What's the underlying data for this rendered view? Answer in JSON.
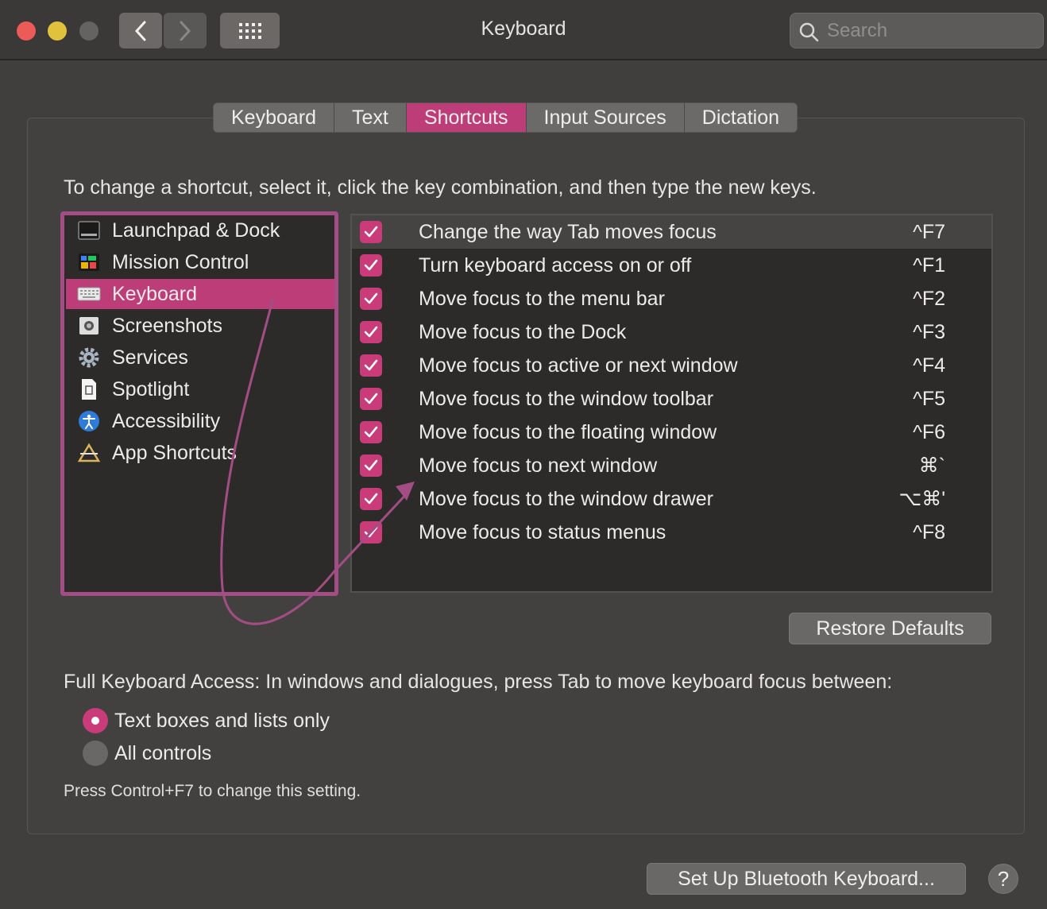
{
  "window": {
    "title": "Keyboard",
    "search_placeholder": "Search"
  },
  "tabs": [
    {
      "label": "Keyboard",
      "active": false
    },
    {
      "label": "Text",
      "active": false
    },
    {
      "label": "Shortcuts",
      "active": true
    },
    {
      "label": "Input Sources",
      "active": false
    },
    {
      "label": "Dictation",
      "active": false
    }
  ],
  "instruction": "To change a shortcut, select it, click the key combination, and then type the new keys.",
  "categories": [
    {
      "label": "Launchpad & Dock",
      "icon": "launchpad-dock-icon",
      "selected": false
    },
    {
      "label": "Mission Control",
      "icon": "mission-control-icon",
      "selected": false
    },
    {
      "label": "Keyboard",
      "icon": "keyboard-icon",
      "selected": true
    },
    {
      "label": "Screenshots",
      "icon": "screenshot-icon",
      "selected": false
    },
    {
      "label": "Services",
      "icon": "gear-icon",
      "selected": false
    },
    {
      "label": "Spotlight",
      "icon": "document-icon",
      "selected": false
    },
    {
      "label": "Accessibility",
      "icon": "accessibility-icon",
      "selected": false
    },
    {
      "label": "App Shortcuts",
      "icon": "app-shortcuts-icon",
      "selected": false
    }
  ],
  "shortcuts": [
    {
      "label": "Change the way Tab moves focus",
      "key": "^F7",
      "checked": true,
      "selected": true
    },
    {
      "label": "Turn keyboard access on or off",
      "key": "^F1",
      "checked": true,
      "selected": false
    },
    {
      "label": "Move focus to the menu bar",
      "key": "^F2",
      "checked": true,
      "selected": false
    },
    {
      "label": "Move focus to the Dock",
      "key": "^F3",
      "checked": true,
      "selected": false
    },
    {
      "label": "Move focus to active or next window",
      "key": "^F4",
      "checked": true,
      "selected": false
    },
    {
      "label": "Move focus to the window toolbar",
      "key": "^F5",
      "checked": true,
      "selected": false
    },
    {
      "label": "Move focus to the floating window",
      "key": "^F6",
      "checked": true,
      "selected": false
    },
    {
      "label": "Move focus to next window",
      "key": "⌘`",
      "checked": true,
      "selected": false
    },
    {
      "label": "Move focus to the window drawer",
      "key": "⌥⌘'",
      "checked": true,
      "selected": false
    },
    {
      "label": "Move focus to status menus",
      "key": "^F8",
      "checked": true,
      "selected": false
    }
  ],
  "restore_defaults_label": "Restore Defaults",
  "full_keyboard_access": {
    "label": "Full Keyboard Access: In windows and dialogues, press Tab to move keyboard focus between:",
    "options": [
      {
        "label": "Text boxes and lists only",
        "selected": true
      },
      {
        "label": "All controls",
        "selected": false
      }
    ],
    "hint": "Press Control+F7 to change this setting."
  },
  "bluetooth_button_label": "Set Up Bluetooth Keyboard...",
  "help_label": "?",
  "colors": {
    "accent": "#bd3d78",
    "annotation": "#a24e85"
  }
}
